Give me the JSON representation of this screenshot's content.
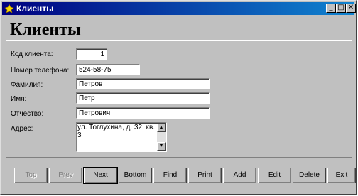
{
  "window": {
    "title": "Клиенты",
    "controls": {
      "minimize": "_",
      "maximize": "□",
      "close": "✕"
    }
  },
  "heading": "Клиенты",
  "fields": {
    "client_id": {
      "label": "Код клиента:",
      "value": "1"
    },
    "phone": {
      "label": "Номер телефона:",
      "value": "524-58-75"
    },
    "surname": {
      "label": "Фамилия:",
      "value": "Петров"
    },
    "name": {
      "label": "Имя:",
      "value": "Петр"
    },
    "patronymic": {
      "label": "Отчество:",
      "value": "Петрович"
    },
    "address": {
      "label": "Адрес:",
      "value": "ул. Тоглухина, д. 32, кв. 3"
    }
  },
  "buttons": {
    "top": "Top",
    "prev": "Prev",
    "next": "Next",
    "bottom": "Bottom",
    "find": "Find",
    "print": "Print",
    "add": "Add",
    "edit": "Edit",
    "delete": "Delete",
    "exit": "Exit"
  },
  "icons": {
    "app": "access-form-icon",
    "scroll_up": "scroll-up-arrow-icon",
    "scroll_down": "scroll-down-arrow-icon"
  }
}
